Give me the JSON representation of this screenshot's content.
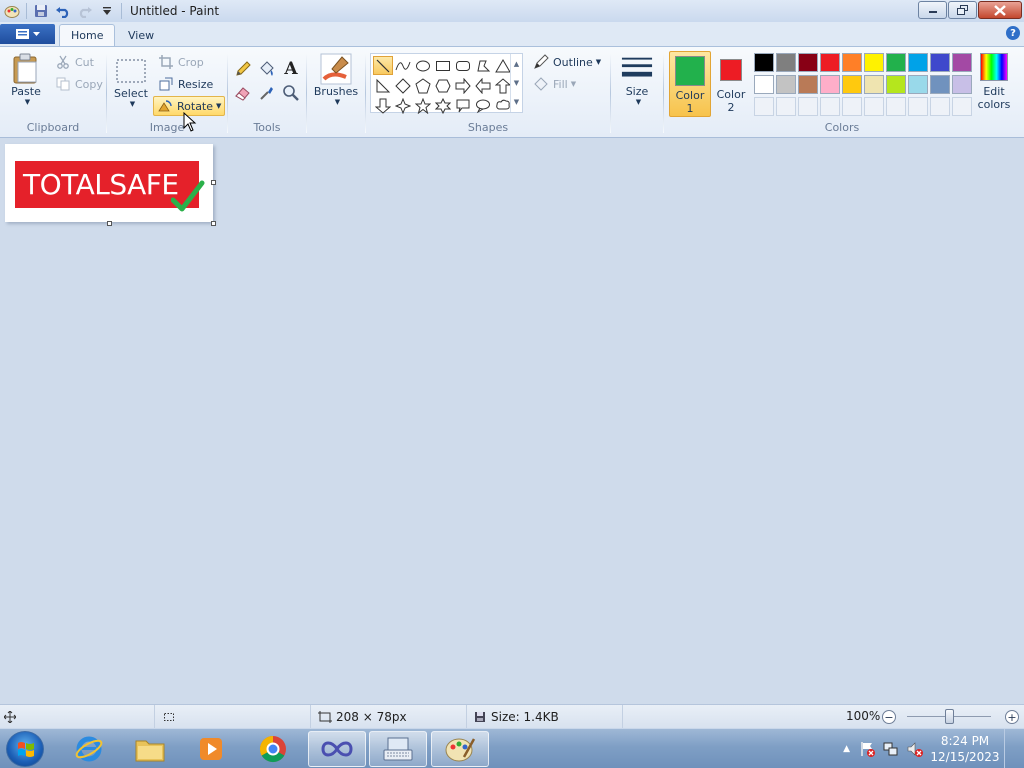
{
  "window": {
    "title": "Untitled - Paint"
  },
  "tabs": {
    "home": "Home",
    "view": "View"
  },
  "help": "?",
  "clipboard": {
    "label": "Clipboard",
    "paste": "Paste",
    "cut": "Cut",
    "copy": "Copy"
  },
  "image": {
    "label": "Image",
    "select": "Select",
    "crop": "Crop",
    "resize": "Resize",
    "rotate": "Rotate"
  },
  "tools": {
    "label": "Tools",
    "text_tool": "A"
  },
  "brushes": {
    "label": "Brushes"
  },
  "shapes": {
    "label": "Shapes",
    "outline": "Outline",
    "fill": "Fill"
  },
  "size": {
    "label": "Size"
  },
  "colors": {
    "label": "Colors",
    "color1_line1": "Color",
    "color1_line2": "1",
    "color2_line1": "Color",
    "color2_line2": "2",
    "edit_line1": "Edit",
    "edit_line2": "colors",
    "color1_value": "#22b14c",
    "color2_value": "#ed1c24",
    "palette_row1": [
      "#000000",
      "#7f7f7f",
      "#880015",
      "#ed1c24",
      "#ff7f27",
      "#fff200",
      "#22b14c",
      "#00a2e8",
      "#3f48cc",
      "#a349a4"
    ],
    "palette_row2": [
      "#ffffff",
      "#c3c3c3",
      "#b97a57",
      "#ffaec9",
      "#ffc90e",
      "#efe4b0",
      "#b5e61d",
      "#99d9ea",
      "#7092be",
      "#c8bfe7"
    ]
  },
  "canvas": {
    "logo_text": "TOTALSAFE",
    "logo_bg": "#e5212a",
    "check_color": "#2bb04a"
  },
  "status": {
    "dimensions": "208 × 78px",
    "size": "Size: 1.4KB",
    "zoom": "100%",
    "zoom_minus": "−",
    "zoom_plus": "+"
  },
  "taskbar": {
    "time": "8:24 PM",
    "date": "12/15/2023"
  }
}
